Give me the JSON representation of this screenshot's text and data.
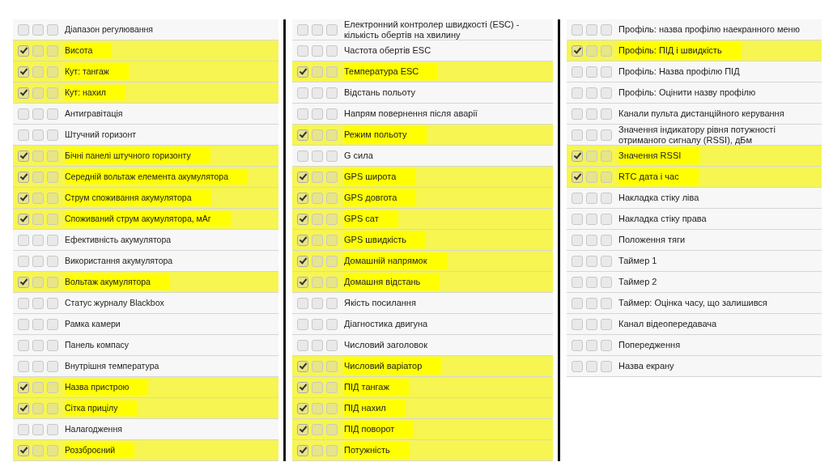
{
  "columns": [
    {
      "items": [
        {
          "label": "Діапазон регулювання",
          "checks": [
            false,
            false,
            false
          ]
        },
        {
          "label": "Висота",
          "checks": [
            true,
            false,
            false
          ]
        },
        {
          "label": "Кут: тангаж",
          "checks": [
            true,
            false,
            false
          ]
        },
        {
          "label": "Кут: нахил",
          "checks": [
            true,
            false,
            false
          ]
        },
        {
          "label": "Антигравітація",
          "checks": [
            false,
            false,
            false
          ]
        },
        {
          "label": "Штучний горизонт",
          "checks": [
            false,
            false,
            false
          ]
        },
        {
          "label": "Бічні панелі штучного горизонту",
          "checks": [
            true,
            false,
            false
          ]
        },
        {
          "label": "Середній вольтаж елемента акумулятора",
          "checks": [
            true,
            false,
            false
          ]
        },
        {
          "label": "Струм споживання акумулятора",
          "checks": [
            true,
            false,
            false
          ]
        },
        {
          "label": "Споживаний струм акумулятора, мАг",
          "checks": [
            true,
            false,
            false
          ]
        },
        {
          "label": "Ефективність акумулятора",
          "checks": [
            false,
            false,
            false
          ]
        },
        {
          "label": "Використання акумулятора",
          "checks": [
            false,
            false,
            false
          ]
        },
        {
          "label": "Вольтаж акумулятора",
          "checks": [
            true,
            false,
            false
          ]
        },
        {
          "label": "Статус журналу Blackbox",
          "checks": [
            false,
            false,
            false
          ]
        },
        {
          "label": "Рамка камери",
          "checks": [
            false,
            false,
            false
          ]
        },
        {
          "label": "Панель компасу",
          "checks": [
            false,
            false,
            false
          ]
        },
        {
          "label": "Внутрішня температура",
          "checks": [
            false,
            false,
            false
          ]
        },
        {
          "label": "Назва пристрою",
          "checks": [
            true,
            false,
            false
          ]
        },
        {
          "label": "Сітка прицілу",
          "checks": [
            true,
            false,
            false
          ]
        },
        {
          "label": "Налагодження",
          "checks": [
            false,
            false,
            false
          ]
        },
        {
          "label": "Роззброєний",
          "checks": [
            true,
            false,
            false
          ]
        }
      ]
    },
    {
      "items": [
        {
          "label": "Електронний контролер швидкості (ESC) - кількість обертів на хвилину",
          "checks": [
            false,
            false,
            false
          ]
        },
        {
          "label": "Частота обертів ESC",
          "checks": [
            false,
            false,
            false
          ]
        },
        {
          "label": "Температура ESC",
          "checks": [
            true,
            false,
            false
          ]
        },
        {
          "label": "Відстань польоту",
          "checks": [
            false,
            false,
            false
          ]
        },
        {
          "label": "Напрям повернення після аварії",
          "checks": [
            false,
            false,
            false
          ]
        },
        {
          "label": "Режим польоту",
          "checks": [
            true,
            false,
            false
          ]
        },
        {
          "label": "G сила",
          "checks": [
            false,
            false,
            false
          ]
        },
        {
          "label": "GPS широта",
          "checks": [
            true,
            false,
            false
          ]
        },
        {
          "label": "GPS довгота",
          "checks": [
            true,
            false,
            false
          ]
        },
        {
          "label": "GPS сат",
          "checks": [
            true,
            false,
            false
          ]
        },
        {
          "label": "GPS швидкість",
          "checks": [
            true,
            false,
            false
          ]
        },
        {
          "label": "Домашній напрямок",
          "checks": [
            true,
            false,
            false
          ]
        },
        {
          "label": "Домашня відстань",
          "checks": [
            true,
            false,
            false
          ]
        },
        {
          "label": "Якість посилання",
          "checks": [
            false,
            false,
            false
          ]
        },
        {
          "label": "Діагностика двигуна",
          "checks": [
            false,
            false,
            false
          ]
        },
        {
          "label": "Числовий заголовок",
          "checks": [
            false,
            false,
            false
          ]
        },
        {
          "label": "Числовий варіатор",
          "checks": [
            true,
            false,
            false
          ]
        },
        {
          "label": "ПІД тангаж",
          "checks": [
            true,
            false,
            false
          ]
        },
        {
          "label": "ПІД нахил",
          "checks": [
            true,
            false,
            false
          ]
        },
        {
          "label": "ПІД поворот",
          "checks": [
            true,
            false,
            false
          ]
        },
        {
          "label": "Потужність",
          "checks": [
            true,
            false,
            false
          ]
        }
      ]
    },
    {
      "items": [
        {
          "label": "Профіль: назва профілю наекранного меню",
          "checks": [
            false,
            false,
            false
          ]
        },
        {
          "label": "Профіль: ПІД і швидкість",
          "checks": [
            true,
            false,
            false
          ]
        },
        {
          "label": "Профіль: Назва профілю ПІД",
          "checks": [
            false,
            false,
            false
          ]
        },
        {
          "label": "Профіль: Оцінити назву профілю",
          "checks": [
            false,
            false,
            false
          ]
        },
        {
          "label": "Канали пульта дистанційного керування",
          "checks": [
            false,
            false,
            false
          ]
        },
        {
          "label": "Значення індикатору рівня потужності отриманого сигналу (RSSI), дБм",
          "checks": [
            false,
            false,
            false
          ]
        },
        {
          "label": "Значення RSSI",
          "checks": [
            true,
            false,
            false
          ]
        },
        {
          "label": "RTC дата і час",
          "checks": [
            true,
            false,
            false
          ]
        },
        {
          "label": "Накладка стіку ліва",
          "checks": [
            false,
            false,
            false
          ]
        },
        {
          "label": "Накладка стіку права",
          "checks": [
            false,
            false,
            false
          ]
        },
        {
          "label": "Положення тяги",
          "checks": [
            false,
            false,
            false
          ]
        },
        {
          "label": "Таймер 1",
          "checks": [
            false,
            false,
            false
          ]
        },
        {
          "label": "Таймер 2",
          "checks": [
            false,
            false,
            false
          ]
        },
        {
          "label": "Таймер: Оцінка часу, що залишився",
          "checks": [
            false,
            false,
            false
          ]
        },
        {
          "label": "Канал відеопередавача",
          "checks": [
            false,
            false,
            false
          ]
        },
        {
          "label": "Попередження",
          "checks": [
            false,
            false,
            false
          ]
        },
        {
          "label": "Назва екрану",
          "checks": [
            false,
            false,
            false
          ]
        }
      ]
    }
  ]
}
